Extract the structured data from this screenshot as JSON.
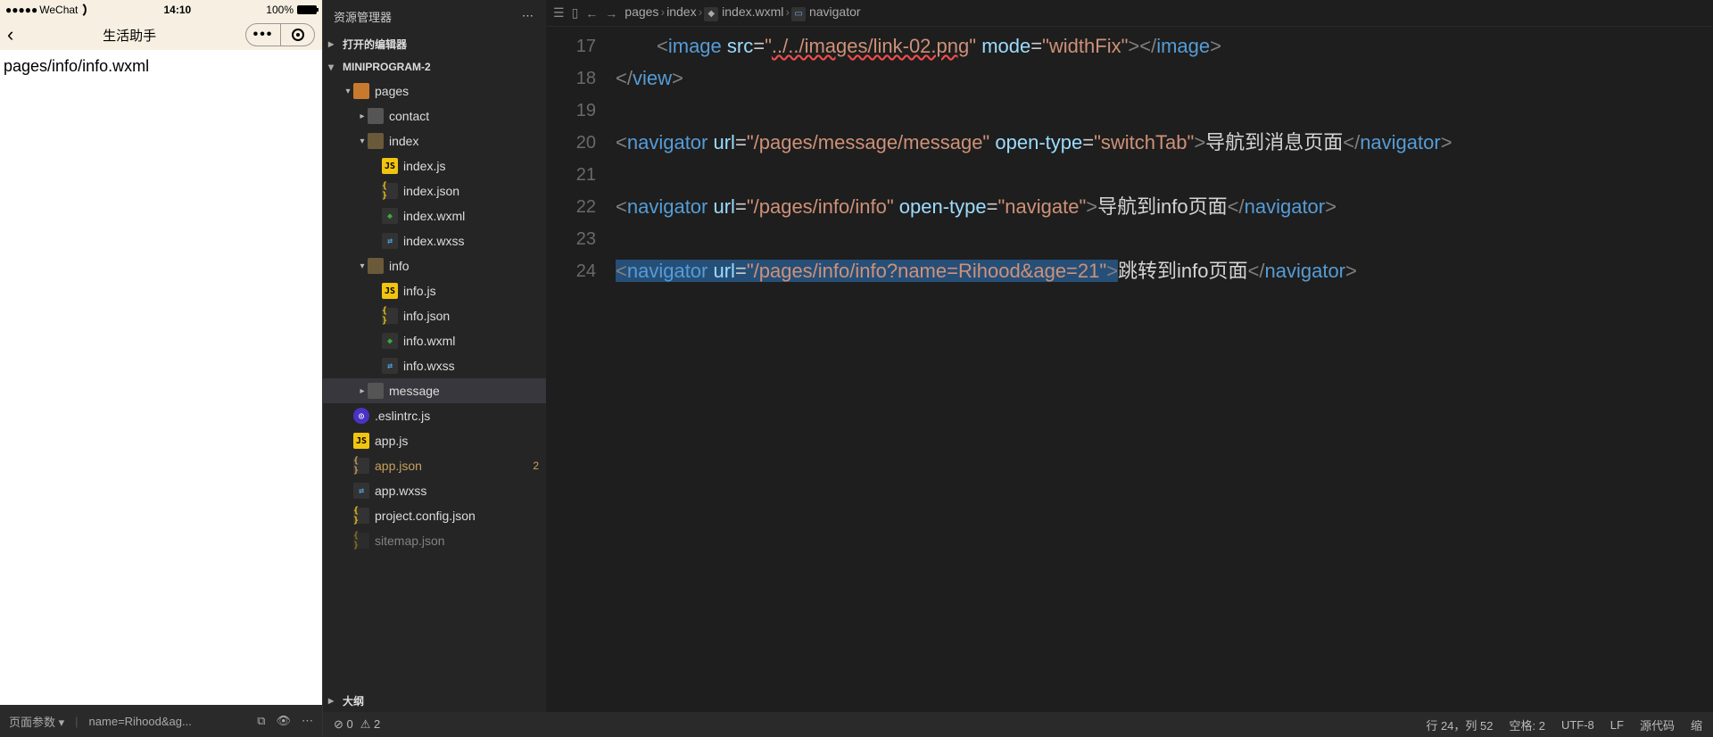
{
  "simulator": {
    "carrier": "WeChat",
    "time": "14:10",
    "battery": "100%",
    "nav_title": "生活助手",
    "page_text": "pages/info/info.wxml",
    "footer": {
      "params_label": "页面参数",
      "params_value": "name=Rihood&ag..."
    }
  },
  "explorer": {
    "title": "资源管理器",
    "section_open_editors": "打开的编辑器",
    "project": "MINIPROGRAM-2",
    "outline": "大纲",
    "tree": [
      {
        "d": 1,
        "chev": "▾",
        "ico": "folder pages",
        "lbl": "pages"
      },
      {
        "d": 2,
        "chev": "▸",
        "ico": "folder",
        "lbl": "contact"
      },
      {
        "d": 2,
        "chev": "▾",
        "ico": "folder open",
        "lbl": "index"
      },
      {
        "d": 3,
        "ico": "js",
        "icoTxt": "JS",
        "lbl": "index.js"
      },
      {
        "d": 3,
        "ico": "json",
        "icoTxt": "{ }",
        "lbl": "index.json"
      },
      {
        "d": 3,
        "ico": "wxml",
        "icoTxt": "◆",
        "lbl": "index.wxml"
      },
      {
        "d": 3,
        "ico": "wxss",
        "icoTxt": "⇄",
        "lbl": "index.wxss"
      },
      {
        "d": 2,
        "chev": "▾",
        "ico": "folder open",
        "lbl": "info"
      },
      {
        "d": 3,
        "ico": "js",
        "icoTxt": "JS",
        "lbl": "info.js"
      },
      {
        "d": 3,
        "ico": "json",
        "icoTxt": "{ }",
        "lbl": "info.json"
      },
      {
        "d": 3,
        "ico": "wxml",
        "icoTxt": "◆",
        "lbl": "info.wxml"
      },
      {
        "d": 3,
        "ico": "wxss",
        "icoTxt": "⇄",
        "lbl": "info.wxss"
      },
      {
        "d": 2,
        "chev": "▸",
        "ico": "folder",
        "lbl": "message",
        "sel": true
      },
      {
        "d": 1,
        "ico": "eslint",
        "icoTxt": "◎",
        "lbl": ".eslintrc.js"
      },
      {
        "d": 1,
        "ico": "js",
        "icoTxt": "JS",
        "lbl": "app.js"
      },
      {
        "d": 1,
        "ico": "json",
        "icoTxt": "{ }",
        "lbl": "app.json",
        "badge": "2",
        "modified": true
      },
      {
        "d": 1,
        "ico": "wxss",
        "icoTxt": "⇄",
        "lbl": "app.wxss"
      },
      {
        "d": 1,
        "ico": "json",
        "icoTxt": "{ }",
        "lbl": "project.config.json"
      },
      {
        "d": 1,
        "ico": "json",
        "icoTxt": "{ }",
        "lbl": "sitemap.json",
        "cut": true
      }
    ]
  },
  "breadcrumbs": {
    "path": [
      "pages",
      "index",
      "index.wxml",
      "navigator"
    ]
  },
  "code": [
    {
      "n": 17,
      "ind": true,
      "html": "<span class='pnc'>&lt;</span><span class='tag'>image</span> <span class='attr'>src</span>=<span class='val'>\"</span><span class='lnk'>../../images/link-02.png</span><span class='val'>\"</span> <span class='attr'>mode</span>=<span class='val'>\"widthFix\"</span><span class='pnc'>&gt;&lt;/</span><span class='tag'>image</span><span class='pnc'>&gt;</span>"
    },
    {
      "n": 18,
      "html": "<span class='pnc'>&lt;/</span><span class='tag'>view</span><span class='pnc'>&gt;</span>"
    },
    {
      "n": 19,
      "html": ""
    },
    {
      "n": 20,
      "html": "<span class='pnc'>&lt;</span><span class='tag'>navigator</span> <span class='attr'>url</span>=<span class='val'>\"/pages/message/message\"</span> <span class='attr'>open-type</span>=<span class='val'>\"switchTab\"</span><span class='pnc'>&gt;</span><span class='txt-plain'>导航到</span><span class='txt-plain'>消息</span><span class='txt-plain'>页面</span><span class='pnc'>&lt;/</span><span class='tag'>navigator</span><span class='pnc'>&gt;</span>"
    },
    {
      "n": 21,
      "html": ""
    },
    {
      "n": 22,
      "html": "<span class='pnc'>&lt;</span><span class='tag'>navigator</span> <span class='attr'>url</span>=<span class='val'>\"/pages/info/info\"</span> <span class='attr'>open-type</span>=<span class='val'>\"navigate\"</span><span class='pnc'>&gt;</span><span class='txt-plain'>导航到info页面</span><span class='pnc'>&lt;/</span><span class='tag'>navigator</span><span class='pnc'>&gt;</span>"
    },
    {
      "n": 23,
      "html": ""
    },
    {
      "n": 24,
      "html": "<span class='hl'><span class='pnc'>&lt;</span><span class='tag'>navigator</span> <span class='attr'>url</span>=<span class='val'>\"/pages/info/info?name=Rihood&amp;age=21\"</span><span class='pnc'>&gt;</span></span><span class='txt-plain'>跳转到info页面</span><span class='pnc'>&lt;/</span><span class='tag'>navigator</span><span class='pnc'>&gt;</span>"
    }
  ],
  "status": {
    "errors": "0",
    "warnings": "2",
    "ln_col": "行 24，列 52",
    "spaces": "空格: 2",
    "encoding": "UTF-8",
    "eol": "LF",
    "lang": "源代码",
    "ext": "缩"
  }
}
